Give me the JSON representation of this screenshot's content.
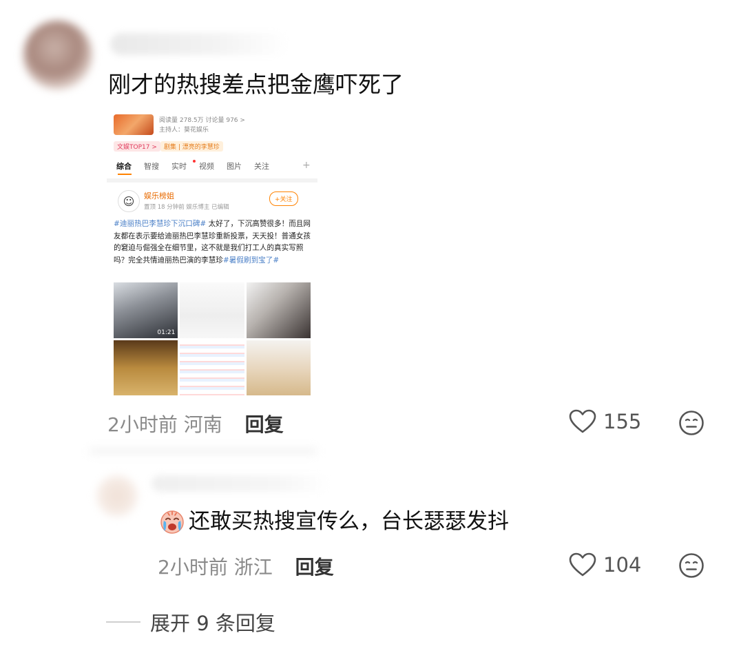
{
  "comments": [
    {
      "text": "刚才的热搜差点把金鹰吓死了",
      "time": "2小时前",
      "location": "河南",
      "reply_label": "回复",
      "likes": "155"
    },
    {
      "text": "还敢买热搜宣传么，台长瑟瑟发抖",
      "time": "2小时前",
      "location": "浙江",
      "reply_label": "回复",
      "likes": "104"
    }
  ],
  "expand_label": "展开 9 条回复",
  "embedded_screenshot": {
    "stats": "阅读量 278.5万  讨论量 976  >",
    "host": "主持人：葵花娱乐",
    "tag_top": "文娱TOP17 >",
    "tag_drama": "剧集 | 漂亮的李慧珍",
    "tabs": [
      "综合",
      "智搜",
      "实时",
      "视频",
      "图片",
      "关注"
    ],
    "author": "娱乐榜姐",
    "author_meta": "置顶  18 分钟前  娱乐博主  已编辑",
    "follow_label": "+关注",
    "body_topic": "#迪丽热巴李慧珍下沉口碑#",
    "body_text": " 太好了，下沉高赞很多！而且网友都在表示要给迪丽热巴李慧珍重新投票，天天投！普通女孩的窘迫与倔强全在细节里，这不就是我们打工人的真实写照吗？完全共情迪丽热巴演的李慧珍",
    "body_topic2": "#暑假刷到宝了#",
    "video_time": "01:21"
  },
  "colors": {
    "accent_orange": "#ff8200",
    "topic_blue": "#4a7fc7",
    "meta_gray": "#8a8a8a"
  }
}
